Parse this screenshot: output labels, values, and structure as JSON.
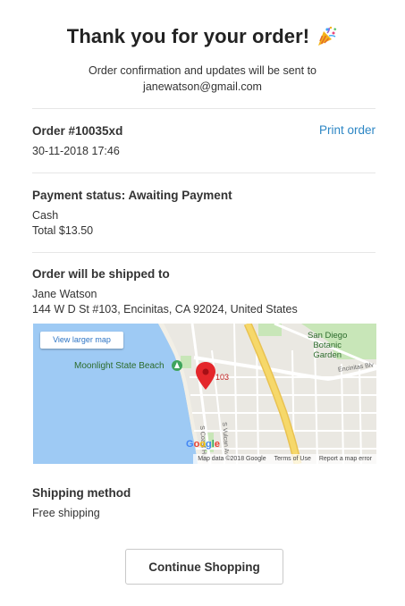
{
  "header": {
    "title": "Thank you for your order!",
    "subtitle_line1": "Order confirmation and updates will be sent to",
    "subtitle_line2": "janewatson@gmail.com"
  },
  "order": {
    "number": "Order #10035xd",
    "date": "30-11-2018 17:46",
    "print_label": "Print order"
  },
  "payment": {
    "title": "Payment status: Awaiting Payment",
    "method": "Cash",
    "total": "Total $13.50"
  },
  "shipping_address": {
    "title": "Order will be shipped to",
    "name": "Jane Watson",
    "address": "144 W D St #103, Encinitas, CA 92024, United States"
  },
  "map": {
    "view_larger_label": "View larger map",
    "beach_label": "Moonlight State Beach",
    "garden_label_1": "San Diego",
    "garden_label_2": "Botanic",
    "garden_label_3": "Garden",
    "pin_label": "103",
    "street_1": "S Coast Hwy",
    "street_2": "S Vulcan Av",
    "street_3": "Encinitas Blv",
    "google_logo": "Google",
    "attribution": "Map data ©2018 Google",
    "terms": "Terms of Use",
    "report": "Report a map error",
    "colors": {
      "water": "#9ecaf4",
      "park": "#c8e6b8",
      "highway": "#f6d86a",
      "pin": "#e4272b"
    }
  },
  "shipping_method": {
    "title": "Shipping method",
    "value": "Free shipping"
  },
  "actions": {
    "continue_label": "Continue Shopping"
  }
}
